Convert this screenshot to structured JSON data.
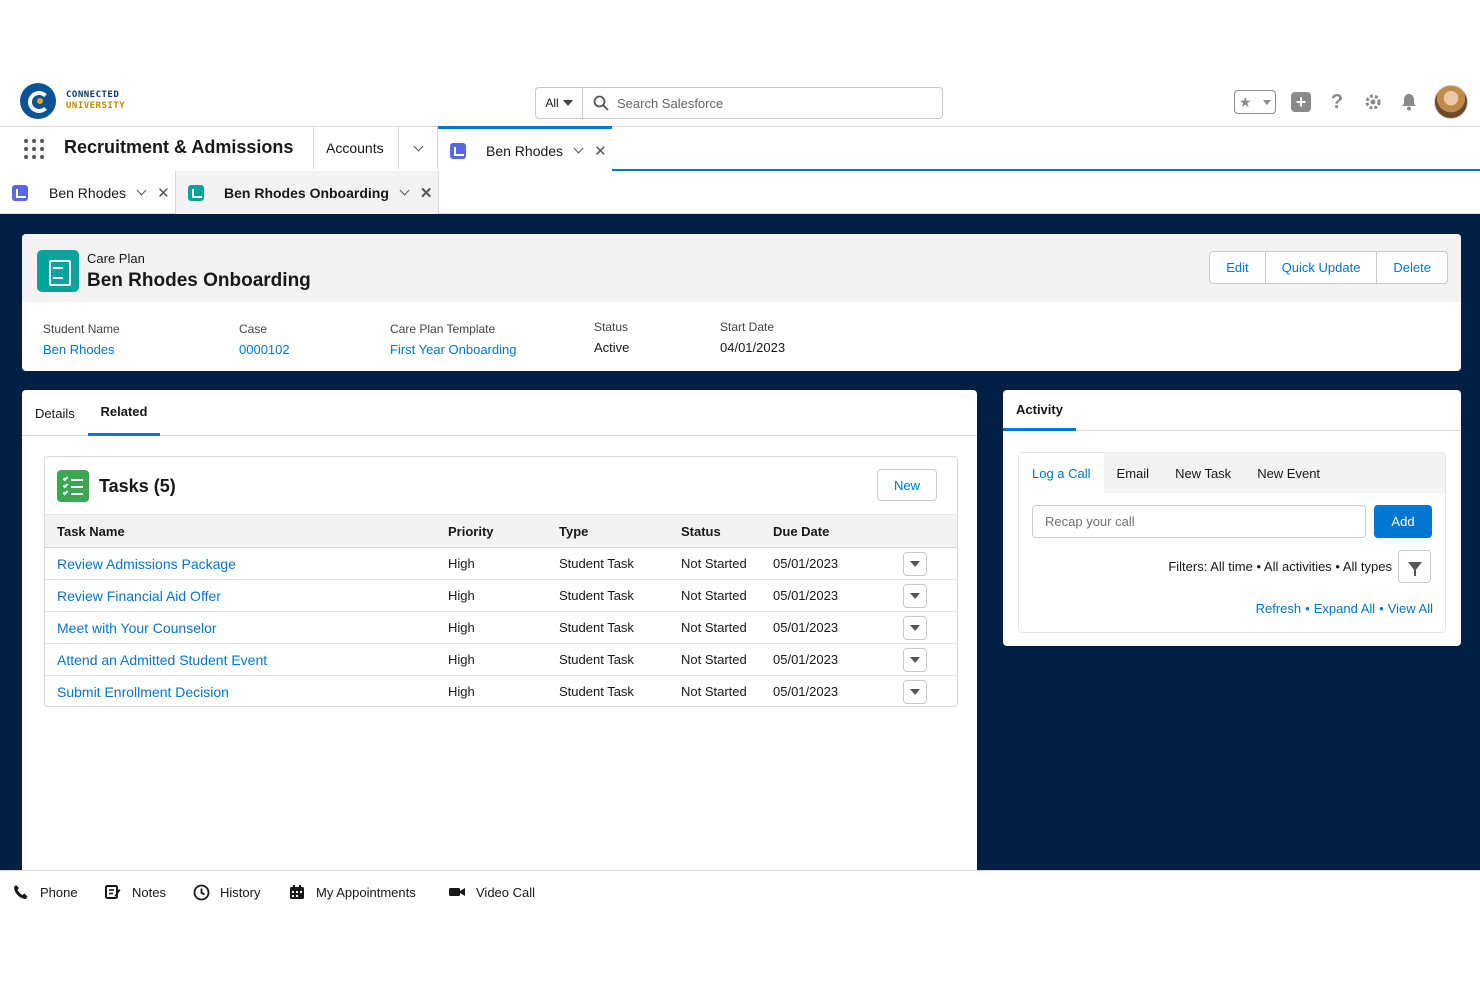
{
  "brand": {
    "line1": "CONNECTED",
    "line2": "UNIVERSITY"
  },
  "search": {
    "scope": "All",
    "placeholder": "Search Salesforce"
  },
  "header_icons": [
    "favorites-star-icon",
    "add-icon",
    "help-icon",
    "setup-gear-icon",
    "notifications-bell-icon",
    "user-avatar"
  ],
  "nav": {
    "app_name": "Recruitment & Admissions",
    "accounts_label": "Accounts",
    "workspace_tab": "Ben Rhodes"
  },
  "subtabs": [
    {
      "label": "Ben Rhodes"
    },
    {
      "label": "Ben Rhodes Onboarding",
      "active": true
    }
  ],
  "record": {
    "object_label": "Care Plan",
    "title": "Ben Rhodes Onboarding",
    "actions": [
      "Edit",
      "Quick Update",
      "Delete"
    ],
    "fields": {
      "student_name": {
        "label": "Student Name",
        "value": "Ben Rhodes"
      },
      "case": {
        "label": "Case",
        "value": "0000102"
      },
      "template": {
        "label": "Care Plan Template",
        "value": "First Year Onboarding"
      },
      "status": {
        "label": "Status",
        "value": "Active"
      },
      "start_date": {
        "label": "Start Date",
        "value": "04/01/2023"
      }
    }
  },
  "record_tabs": {
    "details": "Details",
    "related": "Related"
  },
  "tasks": {
    "title": "Tasks (5)",
    "new_label": "New",
    "columns": [
      "Task Name",
      "Priority",
      "Type",
      "Status",
      "Due Date"
    ],
    "rows": [
      {
        "name": "Review Admissions Package",
        "priority": "High",
        "type": "Student Task",
        "status": "Not Started",
        "due": "05/01/2023"
      },
      {
        "name": "Review Financial Aid Offer",
        "priority": "High",
        "type": "Student Task",
        "status": "Not Started",
        "due": "05/01/2023"
      },
      {
        "name": "Meet with Your Counselor",
        "priority": "High",
        "type": "Student Task",
        "status": "Not Started",
        "due": "05/01/2023"
      },
      {
        "name": "Attend an Admitted Student Event",
        "priority": "High",
        "type": "Student Task",
        "status": "Not Started",
        "due": "05/01/2023"
      },
      {
        "name": "Submit Enrollment Decision",
        "priority": "High",
        "type": "Student Task",
        "status": "Not Started",
        "due": "05/01/2023"
      }
    ]
  },
  "activity": {
    "title": "Activity",
    "publisher_tabs": [
      "Log a Call",
      "Email",
      "New Task",
      "New Event"
    ],
    "recap_placeholder": "Recap your call",
    "add_label": "Add",
    "filters": "Filters: All time • All activities • All types",
    "links": {
      "refresh": "Refresh",
      "expand_all": "Expand All",
      "view_all": "View All",
      "separator": "•"
    }
  },
  "utility_bar": [
    {
      "label": "Phone",
      "icon": "phone-icon"
    },
    {
      "label": "Notes",
      "icon": "notes-icon"
    },
    {
      "label": "History",
      "icon": "history-clock-icon"
    },
    {
      "label": "My Appointments",
      "icon": "calendar-icon"
    },
    {
      "label": "Video Call",
      "icon": "video-camera-icon"
    }
  ],
  "colors": {
    "brand_blue": "#0176d3",
    "dark_background": "#032044",
    "care_plan_teal": "#04a49c",
    "tasks_green": "#3ba755"
  }
}
